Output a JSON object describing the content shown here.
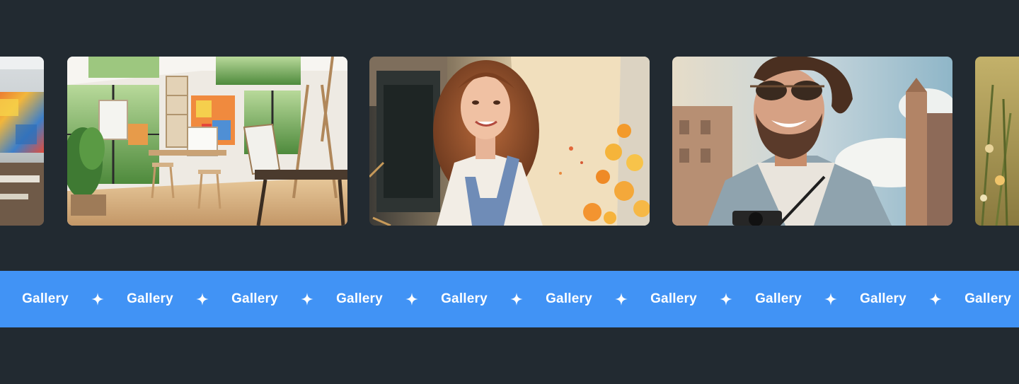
{
  "gallery": {
    "images": [
      {
        "name": "abstract-painting-studio-image",
        "alt": "Colorful abstract paintings in an art studio"
      },
      {
        "name": "art-studio-interior-image",
        "alt": "Sunlit art studio with easels and large windows"
      },
      {
        "name": "smiling-woman-painter-image",
        "alt": "Smiling woman with curly hair painting outdoors"
      },
      {
        "name": "smiling-man-sunglasses-image",
        "alt": "Smiling man with sunglasses and camera outdoors"
      },
      {
        "name": "sunlit-plants-image",
        "alt": "Sunlit plants and flowers"
      }
    ]
  },
  "marquee": {
    "items": [
      {
        "label": "Gallery"
      },
      {
        "label": "Gallery"
      },
      {
        "label": "Gallery"
      },
      {
        "label": "Gallery"
      },
      {
        "label": "Gallery"
      },
      {
        "label": "Gallery"
      },
      {
        "label": "Gallery"
      },
      {
        "label": "Gallery"
      },
      {
        "label": "Gallery"
      },
      {
        "label": "Gallery"
      }
    ],
    "separator_icon": "four-point-star-icon"
  },
  "colors": {
    "background": "#222a31",
    "band": "#4193f5",
    "band_text": "#ffffff"
  }
}
